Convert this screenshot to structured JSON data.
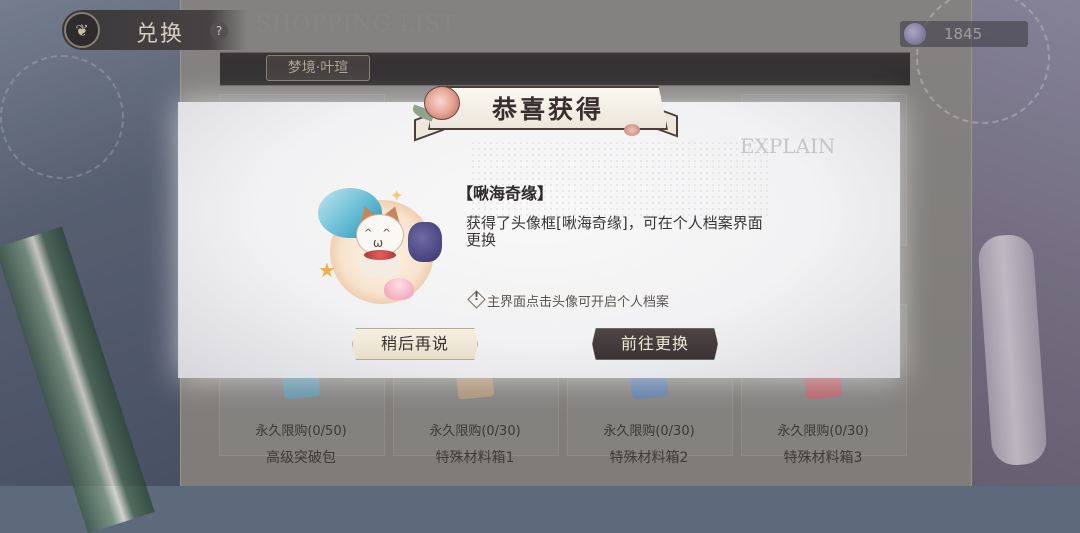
{
  "header": {
    "title": "兑换",
    "help_symbol": "?",
    "shopping_list": "SHOPPING LIST",
    "currency_value": "1845"
  },
  "shop": {
    "tab_label": "梦境·叶瑄",
    "cards": [
      {
        "limit": "永久限购(0/50)",
        "name": "高级突破包",
        "box_color": "#5ea7c7"
      },
      {
        "limit": "永久限购(0/30)",
        "name": "特殊材料箱1",
        "box_color": "#c9a57a"
      },
      {
        "limit": "永久限购(0/30)",
        "name": "特殊材料箱2",
        "box_color": "#5b87c9"
      },
      {
        "limit": "永久限购(0/30)",
        "name": "特殊材料箱3",
        "box_color": "#d4606a"
      }
    ]
  },
  "modal": {
    "title": "恭喜获得",
    "watermark": "EXPLAIN",
    "item_name": "【啾海奇缘】",
    "description": "获得了头像框[啾海奇缘]，可在个人档案界面更换",
    "hint_symbol": "!",
    "hint": "主界面点击头像可开启个人档案",
    "later_button": "稍后再说",
    "go_button": "前往更换"
  },
  "icons": {
    "back": "butterfly-back-icon",
    "help": "help-icon",
    "currency": "dream-crystal-icon",
    "item": "avatar-frame-cat-sea-icon",
    "hint": "info-diamond-icon"
  }
}
